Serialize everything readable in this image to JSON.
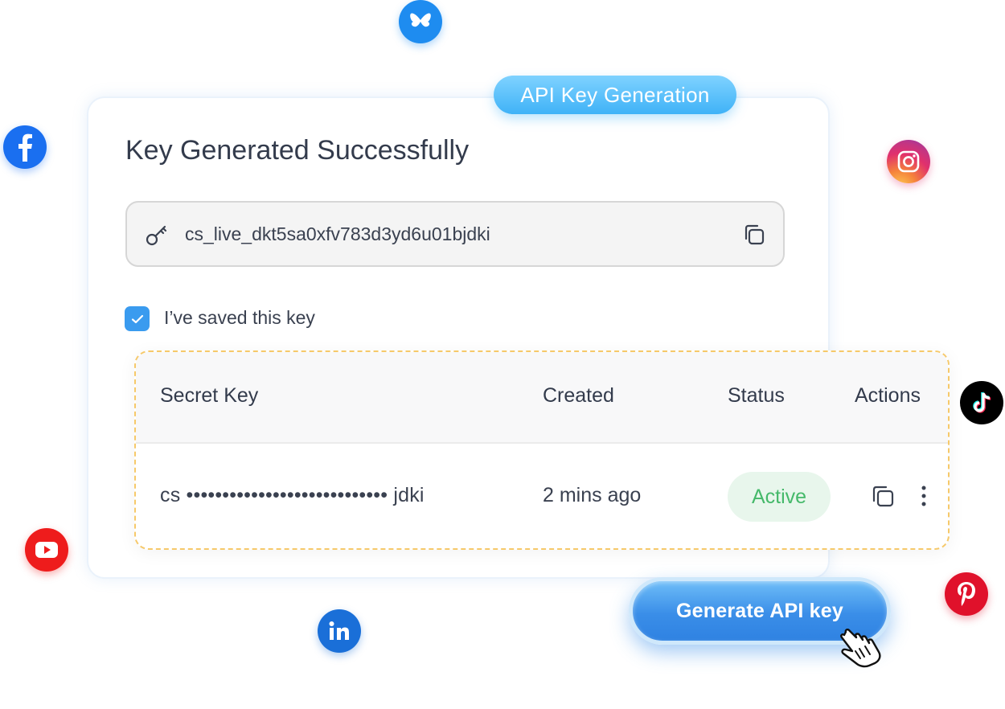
{
  "badge": {
    "label": "API Key Generation"
  },
  "card": {
    "title": "Key Generated Successfully",
    "key_value": "cs_live_dkt5sa0xfv783d3yd6u01bjdki",
    "checkbox_label": "I’ve saved this key",
    "checkbox_checked": true
  },
  "table": {
    "headers": [
      "Secret Key",
      "Created",
      "Status",
      "Actions"
    ],
    "rows": [
      {
        "secret_key": "cs •••••••••••••••••••••••••••• jdki",
        "created": "2 mins ago",
        "status": "Active"
      }
    ]
  },
  "actions": {
    "generate_label": "Generate API key"
  },
  "social_icons": [
    "bluesky-icon",
    "facebook-icon",
    "instagram-icon",
    "tiktok-icon",
    "youtube-icon",
    "linkedin-icon",
    "pinterest-icon"
  ],
  "colors": {
    "accent": "#3a9bef",
    "badge": "#3fb2f7",
    "active_bg": "#e8f6ec",
    "active_text": "#45b96a",
    "dashed_border": "#f6c96a"
  }
}
